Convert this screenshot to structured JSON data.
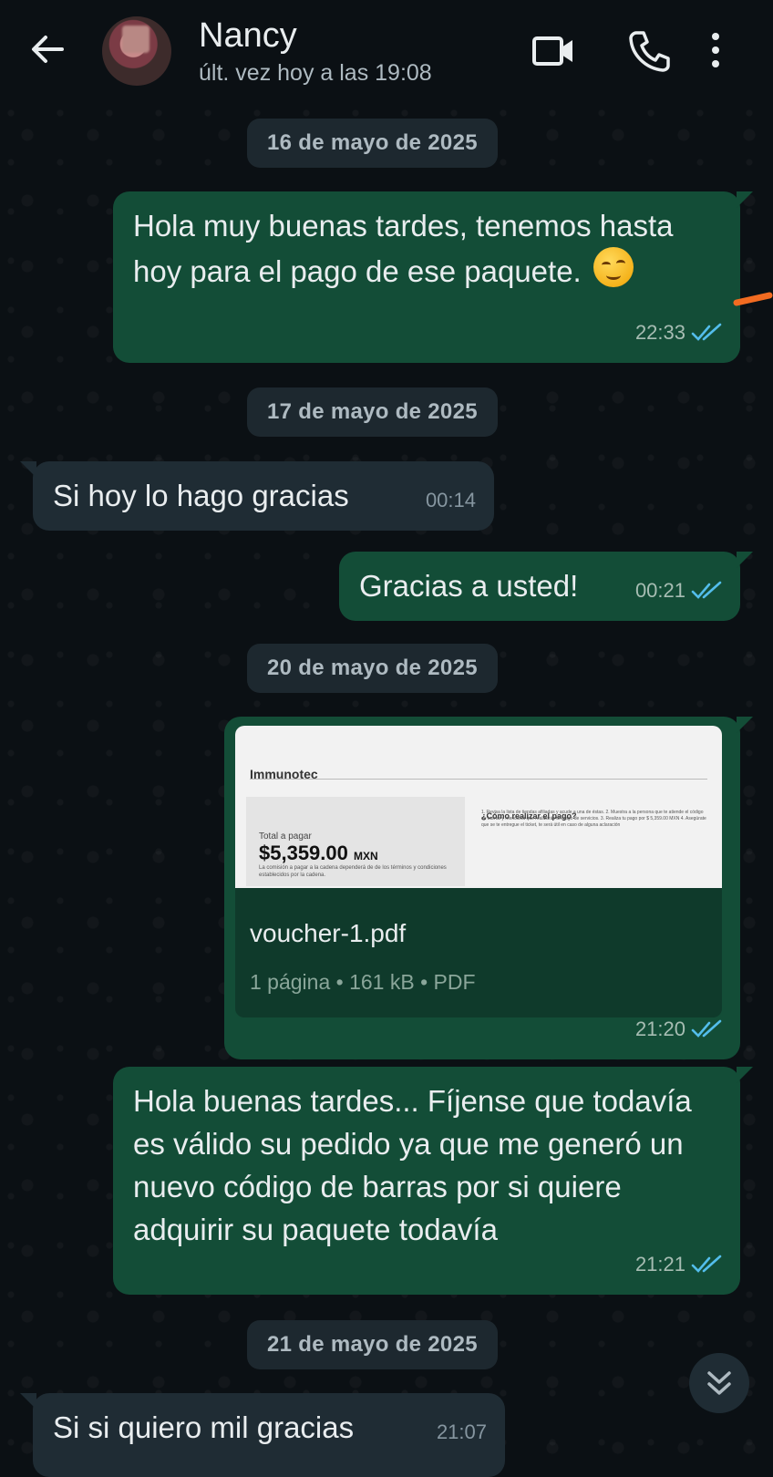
{
  "header": {
    "back_icon": "arrow-left-icon",
    "contact_name": "Nancy",
    "contact_status": "últ. vez hoy a las 19:08",
    "video_icon": "video-camera-icon",
    "call_icon": "phone-icon",
    "menu_icon": "more-vertical-icon"
  },
  "colors": {
    "background": "#0b1014",
    "outgoing_bubble": "#134d37",
    "incoming_bubble": "#1f2c34",
    "date_chip": "#1d282f",
    "read_ticks": "#53bdeb"
  },
  "chat": {
    "date_1": "16 de mayo de 2025",
    "msg_1_text": "Hola muy buenas tardes, tenemos hasta hoy para el pago de ese paquete.",
    "msg_1_emoji": "smirking-face-emoji",
    "msg_1_time": "22:33",
    "date_2": "17 de mayo de 2025",
    "msg_2_text": "Si hoy lo hago gracias",
    "msg_2_time": "00:14",
    "msg_3_text": "Gracias a usted!",
    "msg_3_time": "00:21",
    "date_3": "20 de mayo de 2025",
    "doc": {
      "preview_brand": "Immunotec",
      "preview_total_label": "Total a pagar",
      "preview_total": "$5,359.00",
      "preview_currency": "MXN",
      "preview_note": "La comisión a pagar a la cadena dependerá de de los términos y condiciones establecidos por la cadena.",
      "preview_how": "¿Cómo realizar el pago?",
      "preview_steps": "1. Revisa la lista de tiendas afiliadas y acude a una de éstas. 2. Muestra a la persona que te atiende el código de barras y menciona que realizarás un pago de servicios. 3. Realiza tu pago por $ 5,359.00 MXN 4. Asegúrate que se te entregue el ticket, te será útil en caso de alguna aclaración",
      "filename": "voucher-1.pdf",
      "info": "1 página • 161 kB • PDF",
      "time": "21:20"
    },
    "msg_5_text": "Hola buenas tardes... Fíjense que todavía es válido su pedido ya que me generó un nuevo código de barras por si quiere adquirir su paquete todavía",
    "msg_5_time": "21:21",
    "date_4": "21 de mayo de 2025",
    "msg_6_text": "Si si quiero mil gracias",
    "msg_6_time": "21:07",
    "scroll_icon": "double-chevron-down-icon"
  }
}
